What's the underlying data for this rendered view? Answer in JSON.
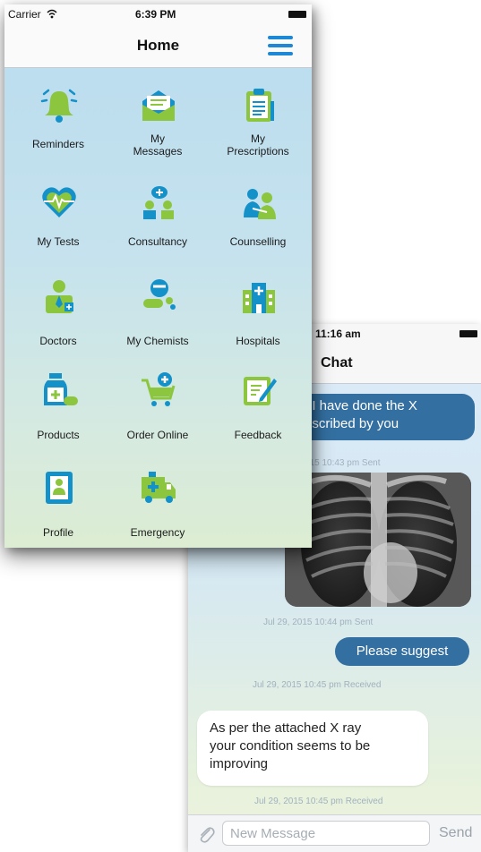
{
  "home": {
    "status": {
      "carrier": "Carrier",
      "time": "6:39 PM"
    },
    "title": "Home",
    "tiles": [
      {
        "label": "Reminders"
      },
      {
        "label1": "My",
        "label2": "Messages"
      },
      {
        "label1": "My",
        "label2": "Prescriptions"
      },
      {
        "label": "My Tests"
      },
      {
        "label": "Consultancy"
      },
      {
        "label": "Counselling"
      },
      {
        "label": "Doctors"
      },
      {
        "label": "My Chemists"
      },
      {
        "label": "Hospitals"
      },
      {
        "label": "Products"
      },
      {
        "label": "Order Online"
      },
      {
        "label": "Feedback"
      },
      {
        "label": "Profile"
      },
      {
        "label": "Emergency"
      }
    ]
  },
  "chat": {
    "status": {
      "time": "11:16 am"
    },
    "title": "Chat",
    "messages": [
      {
        "line1": ". I have done the X",
        "line2": "escribed by you"
      },
      {
        "stamp": "015 10:43 pm Sent"
      },
      {
        "stamp": "Jul 29, 2015 10:44 pm Sent"
      },
      {
        "text": "Please suggest"
      },
      {
        "stamp": "Jul 29, 2015 10:45 pm Received"
      },
      {
        "line1": "As per the attached X ray",
        "line2": "your condition seems to be",
        "line3": "improving"
      },
      {
        "stamp": "Jul 29, 2015 10:45 pm Received"
      }
    ],
    "input": {
      "placeholder": "New Message",
      "send_label": "Send"
    }
  },
  "icons": [
    "bell-icon",
    "envelope-icon",
    "clipboard-icon",
    "heart-pulse-icon",
    "consult-icon",
    "counselling-icon",
    "doctor-icon",
    "pills-icon",
    "hospital-icon",
    "bottle-icon",
    "cart-icon",
    "feedback-icon",
    "profile-icon",
    "ambulance-icon",
    "attachment-icon",
    "hamburger-icon",
    "wifi-icon",
    "battery-icon"
  ],
  "colors": {
    "accent": "#1e88d6",
    "icon_green": "#8cc63f",
    "icon_blue": "#1591c9",
    "sent_bubble": "#336fa0"
  }
}
